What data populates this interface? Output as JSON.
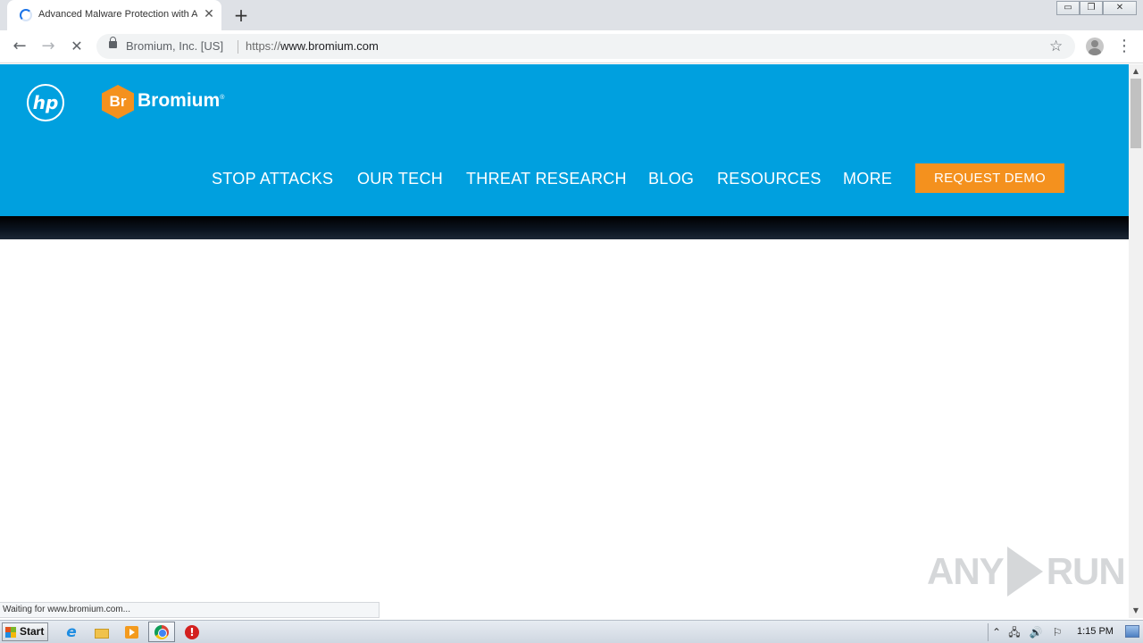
{
  "browser": {
    "tab": {
      "title": "Advanced Malware Protection with A",
      "close_glyph": "✕"
    },
    "new_tab_glyph": "+",
    "window_controls": {
      "minimize": "▭",
      "restore": "❐",
      "close": "✕"
    },
    "nav": {
      "back": "←",
      "forward": "→",
      "stop": "✕"
    },
    "omnibox": {
      "cert_owner": "Bromium, Inc. [US]",
      "url_scheme": "https://",
      "url_host": "www.bromium.com"
    },
    "bookmark_glyph": "☆",
    "menu_glyph": "⋮",
    "status_text": "Waiting for www.bromium.com..."
  },
  "site": {
    "hp_logo_text": "hp",
    "brand_mark": "Br",
    "brand_name": "Bromium",
    "brand_reg": "®",
    "nav_items": [
      {
        "label": "STOP ATTACKS"
      },
      {
        "label": "OUR TECH"
      },
      {
        "label": "THREAT RESEARCH"
      },
      {
        "label": "BLOG"
      },
      {
        "label": "RESOURCES"
      },
      {
        "label": "MORE"
      }
    ],
    "cta_label": "REQUEST DEMO",
    "colors": {
      "header_bg": "#00a0df",
      "accent": "#f4911e"
    }
  },
  "scrollbar": {
    "up": "▲",
    "down": "▼"
  },
  "watermark": {
    "left": "ANY",
    "right": "RUN"
  },
  "taskbar": {
    "start_label": "Start",
    "ie_glyph": "e",
    "stop_glyph": "!",
    "clock": "1:15 PM",
    "tray_glyphs": {
      "expand": "⌃",
      "network": "🖧",
      "volume": "🔊",
      "flag": "⚐"
    }
  }
}
